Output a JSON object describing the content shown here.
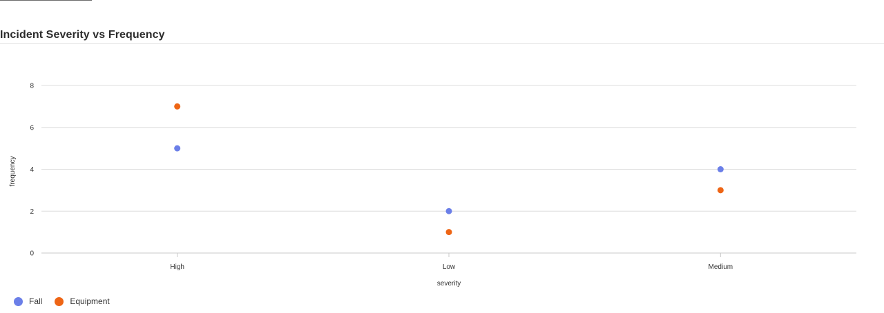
{
  "header": {
    "title": "Incident Severity vs Frequency"
  },
  "chart_data": {
    "type": "scatter",
    "categories": [
      "High",
      "Low",
      "Medium"
    ],
    "series": [
      {
        "name": "Fall",
        "color": "#6b7fe8",
        "values": [
          5,
          2,
          4
        ]
      },
      {
        "name": "Equipment",
        "color": "#ee6515",
        "values": [
          7,
          1,
          3
        ]
      }
    ],
    "xlabel": "severity",
    "ylabel": "frequency",
    "ylim": [
      0,
      8
    ],
    "yticks": [
      0,
      2,
      4,
      6,
      8
    ],
    "grid": true,
    "legend_position": "bottom-left"
  }
}
